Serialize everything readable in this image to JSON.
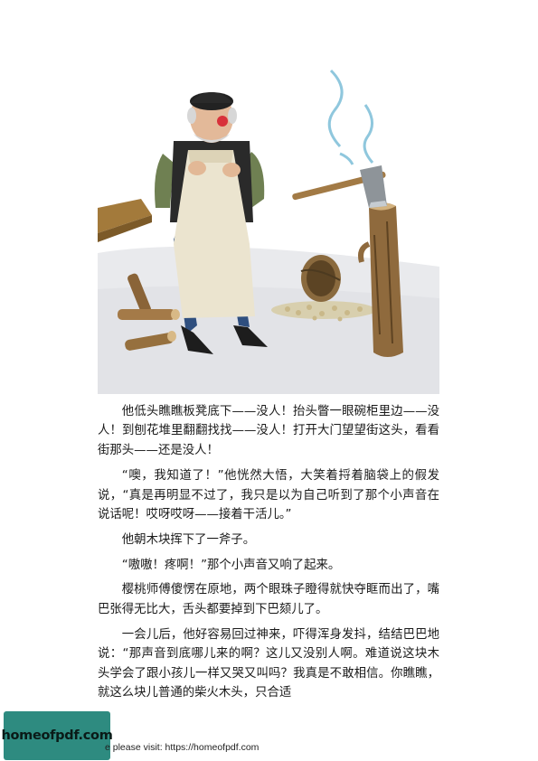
{
  "paragraphs": [
    "他低头瞧瞧板凳底下——没人！抬头瞥一眼碗柜里边——没人！到刨花堆里翻翻找找——没人！打开大门望望街这头，看看街那头——还是没人！",
    "“噢，我知道了！”他恍然大悟，大笑着捋着脑袋上的假发说，“真是再明显不过了，我只是以为自己听到了那个小声音在说话呢！哎呀哎呀——接着干活儿。”",
    "他朝木块挥下了一斧子。",
    "“嗷嗷！疼啊！”那个小声音又响了起来。",
    "樱桃师傅傻愣在原地，两个眼珠子瞪得就快夺眶而出了，嘴巴张得无比大，舌头都要掉到下巴颏儿了。",
    "一会儿后，他好容易回过神来，吓得浑身发抖，结结巴巴地说：“那声音到底哪儿来的啊？这儿又没别人啊。难道说这块木头学会了跟小孩儿一样又哭又叫吗？我真是不敢相信。你瞧瞧，就这么块儿普通的柴火木头，只合适"
  ],
  "watermark": {
    "logo_text": "homeofpdf.com",
    "footer_text": "e please visit: https://homeofpdf.com"
  },
  "colors": {
    "logo_bg": "#2e8b80"
  }
}
